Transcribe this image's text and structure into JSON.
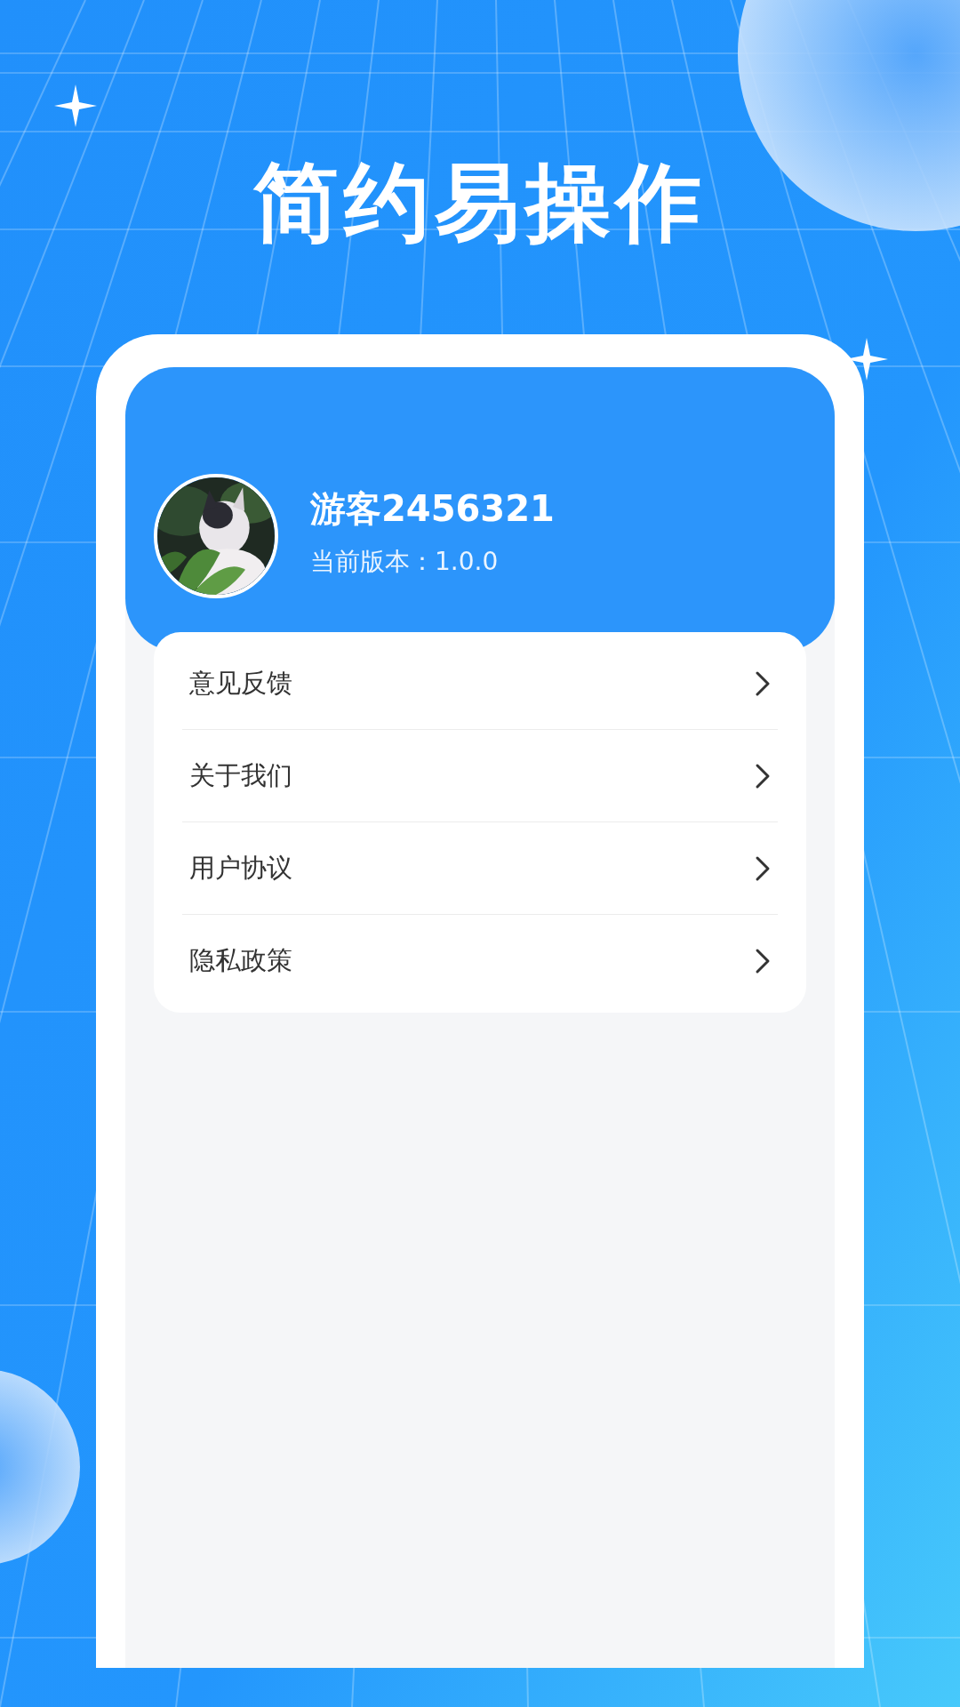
{
  "headline": "简约易操作",
  "profile": {
    "name": "游客2456321",
    "version": "当前版本：1.0.0"
  },
  "menu": [
    {
      "label": "意见反馈"
    },
    {
      "label": "关于我们"
    },
    {
      "label": "用户协议"
    },
    {
      "label": "隐私政策"
    }
  ]
}
